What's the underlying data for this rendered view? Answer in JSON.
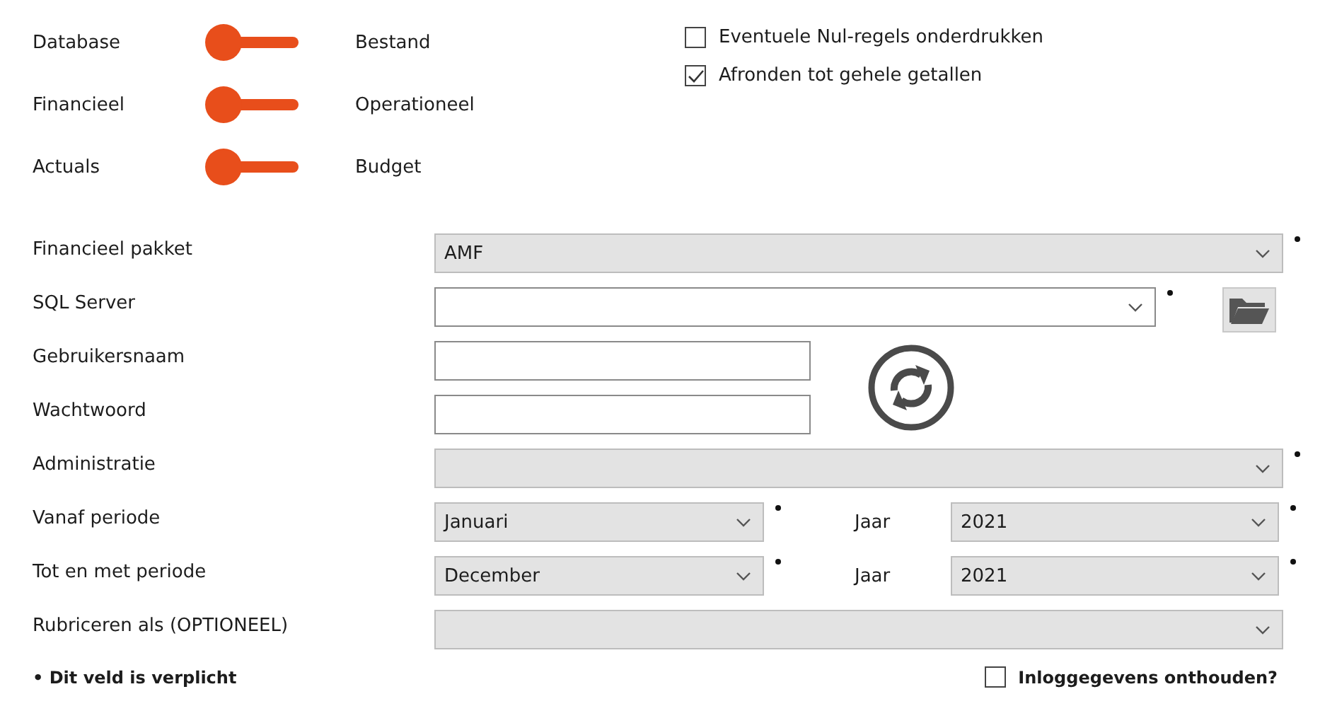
{
  "toggles": [
    {
      "left_label": "Database",
      "right_label": "Bestand",
      "on": false
    },
    {
      "left_label": "Financieel",
      "right_label": "Operationeel",
      "on": false
    },
    {
      "left_label": "Actuals",
      "right_label": "Budget",
      "on": false
    }
  ],
  "options": [
    {
      "label": "Eventuele Nul-regels onderdrukken",
      "checked": false
    },
    {
      "label": "Afronden tot gehele getallen",
      "checked": true
    }
  ],
  "fields": [
    {
      "kind": "dropdown",
      "label": "Financieel pakket",
      "value": "AMF",
      "required": true
    },
    {
      "kind": "combobox",
      "label": "SQL Server",
      "required": true
    },
    {
      "kind": "text",
      "label": "Gebruikersnaam"
    },
    {
      "kind": "text",
      "label": "Wachtwoord"
    },
    {
      "kind": "dropdown",
      "label": "Administratie",
      "required": true
    },
    {
      "kind": "period",
      "label": "Vanaf periode",
      "value": "Januari",
      "required": true,
      "year_label": "Jaar",
      "year_value": "2021",
      "year_required": true
    },
    {
      "kind": "period",
      "label": "Tot en met periode",
      "value": "December",
      "required": true,
      "year_label": "Jaar",
      "year_value": "2021",
      "year_required": true
    },
    {
      "kind": "dropdown",
      "label": "Rubriceren als (OPTIONEEL)",
      "required": false
    }
  ],
  "note": "• Dit veld is verplicht",
  "remember": {
    "label": "Inloggegevens onthouden?",
    "checked": false
  }
}
